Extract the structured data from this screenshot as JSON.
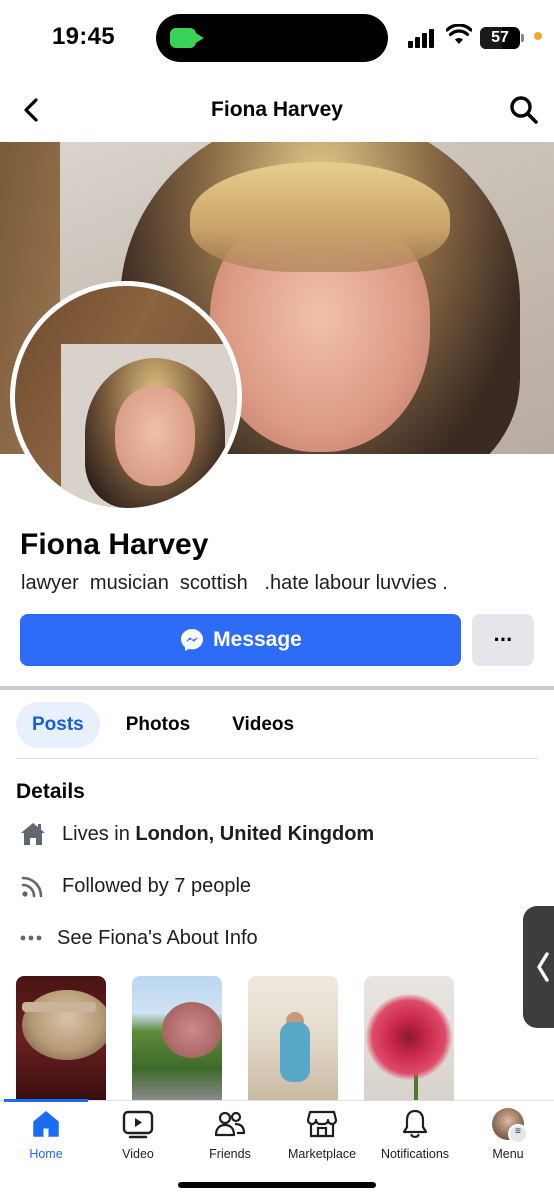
{
  "status_bar": {
    "time": "19:45",
    "battery": "57"
  },
  "header": {
    "title": "Fiona Harvey"
  },
  "profile": {
    "name": "Fiona Harvey",
    "bio": "lawyer  musician  scottish   .hate labour luvvies ."
  },
  "actions": {
    "message_label": "Message",
    "more_label": "···"
  },
  "tabs": [
    {
      "label": "Posts",
      "active": true
    },
    {
      "label": "Photos",
      "active": false
    },
    {
      "label": "Videos",
      "active": false
    }
  ],
  "details": {
    "title": "Details",
    "lives_prefix": "Lives in ",
    "lives_place": "London, United Kingdom",
    "followed": "Followed by 7 people",
    "about": "See Fiona's About Info"
  },
  "bottom_nav": [
    {
      "label": "Home",
      "icon": "home-icon",
      "active": true
    },
    {
      "label": "Video",
      "icon": "video-icon",
      "active": false
    },
    {
      "label": "Friends",
      "icon": "friends-icon",
      "active": false
    },
    {
      "label": "Marketplace",
      "icon": "marketplace-icon",
      "active": false
    },
    {
      "label": "Notifications",
      "icon": "bell-icon",
      "active": false
    },
    {
      "label": "Menu",
      "icon": "menu-avatar",
      "active": false
    }
  ],
  "colors": {
    "accent": "#1b6cf2",
    "message_button": "#2d6cf6",
    "tab_active_bg": "#e7f0fc"
  }
}
